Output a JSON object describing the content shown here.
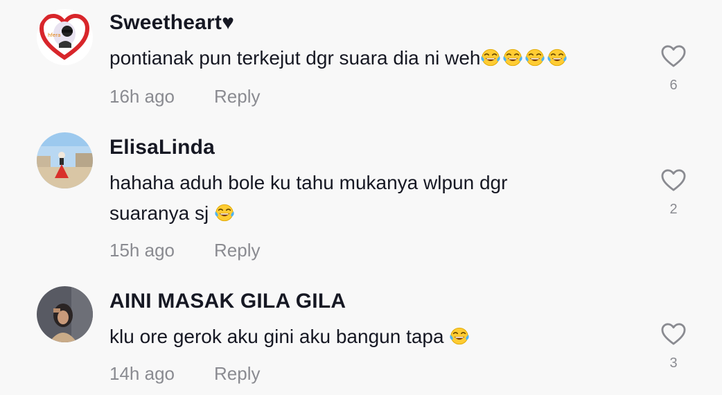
{
  "comments": [
    {
      "username": "Sweetheart♥",
      "text": "pontianak pun terkejut dgr suara dia ni weh",
      "emoji_count": 4,
      "time": "16h ago",
      "reply_label": "Reply",
      "likes": "6",
      "avatar_icon": "heart-frame-avatar"
    },
    {
      "username": "ElisaLinda",
      "text_line1": "hahaha aduh bole ku tahu mukanya wlpun dgr",
      "text_line2": "suaranya sj",
      "emoji_count": 1,
      "time": "15h ago",
      "reply_label": "Reply",
      "likes": "2",
      "avatar_icon": "photo-avatar"
    },
    {
      "username": "AINI MASAK GILA GILA",
      "text": "klu ore gerok aku gini aku bangun tapa",
      "emoji_count": 1,
      "time": "14h ago",
      "reply_label": "Reply",
      "likes": "3",
      "avatar_icon": "photo-avatar"
    }
  ],
  "colors": {
    "background": "#f8f8f8",
    "text": "#161823",
    "secondary": "#8a8b91",
    "heart_outline": "#8a8b91"
  }
}
